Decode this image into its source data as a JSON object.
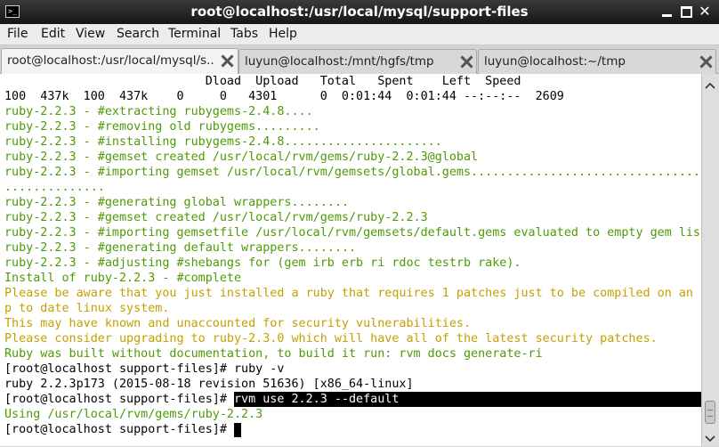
{
  "window": {
    "title": "root@localhost:/usr/local/mysql/support-files",
    "app_icon": "terminal-icon",
    "controls": [
      "minimize-icon",
      "maximize-icon",
      "close-icon"
    ],
    "close_glyph": "✕"
  },
  "menu": {
    "items": [
      {
        "label": "File"
      },
      {
        "label": "Edit"
      },
      {
        "label": "View"
      },
      {
        "label": "Search"
      },
      {
        "label": "Terminal"
      },
      {
        "label": "Tabs"
      },
      {
        "label": "Help"
      }
    ]
  },
  "tabs": [
    {
      "label": "root@localhost:/usr/local/mysql/s...",
      "active": true
    },
    {
      "label": "luyun@localhost:/mnt/hgfs/tmp",
      "active": false
    },
    {
      "label": "luyun@localhost:~/tmp",
      "active": false
    }
  ],
  "terminal": {
    "lines": [
      {
        "text": "                            Dload  Upload   Total   Spent    Left  Speed",
        "color": "default"
      },
      {
        "text": "100  437k  100  437k    0     0   4301      0  0:01:44  0:01:44 --:--:--  2609",
        "color": "default"
      },
      {
        "text": "ruby-2.2.3 - #extracting rubygems-2.4.8....",
        "color": "green"
      },
      {
        "text": "ruby-2.2.3 - #removing old rubygems.........",
        "color": "green"
      },
      {
        "text": "ruby-2.2.3 - #installing rubygems-2.4.8......................",
        "color": "green"
      },
      {
        "text": "ruby-2.2.3 - #gemset created /usr/local/rvm/gems/ruby-2.2.3@global",
        "color": "green"
      },
      {
        "text": "ruby-2.2.3 - #importing gemset /usr/local/rvm/gemsets/global.gems.................................",
        "color": "green"
      },
      {
        "text": "..............",
        "color": "green"
      },
      {
        "text": "ruby-2.2.3 - #generating global wrappers........",
        "color": "green"
      },
      {
        "text": "ruby-2.2.3 - #gemset created /usr/local/rvm/gems/ruby-2.2.3",
        "color": "green"
      },
      {
        "text": "ruby-2.2.3 - #importing gemsetfile /usr/local/rvm/gemsets/default.gems evaluated to empty gem list",
        "color": "green"
      },
      {
        "text": "ruby-2.2.3 - #generating default wrappers........",
        "color": "green"
      },
      {
        "text": "ruby-2.2.3 - #adjusting #shebangs for (gem irb erb ri rdoc testrb rake).",
        "color": "green"
      },
      {
        "text": "Install of ruby-2.2.3 - #complete",
        "color": "green"
      },
      {
        "text": "Please be aware that you just installed a ruby that requires 1 patches just to be compiled on an u",
        "color": "gold"
      },
      {
        "text": "p to date linux system.",
        "color": "gold"
      },
      {
        "text": "This may have known and unaccounted for security vulnerabilities.",
        "color": "gold"
      },
      {
        "text": "Please consider upgrading to ruby-2.3.0 which will have all of the latest security patches.",
        "color": "gold"
      },
      {
        "text": "Ruby was built without documentation, to build it run: rvm docs generate-ri",
        "color": "green"
      },
      {
        "text": "[root@localhost support-files]# ruby -v",
        "color": "default"
      },
      {
        "text": "ruby 2.2.3p173 (2015-08-18 revision 51636) [x86_64-linux]",
        "color": "default"
      },
      {
        "text": "[root@localhost support-files]# ",
        "color": "default",
        "selected": "rvm use 2.2.3 --default"
      },
      {
        "text": "Using /usr/local/rvm/gems/ruby-2.2.3",
        "color": "green"
      },
      {
        "text": "[root@localhost support-files]# ",
        "color": "default",
        "cursor": true
      }
    ]
  },
  "colors": {
    "green": "#4e9a06",
    "gold": "#c4a000",
    "default": "#000000",
    "background": "#ffffff"
  }
}
